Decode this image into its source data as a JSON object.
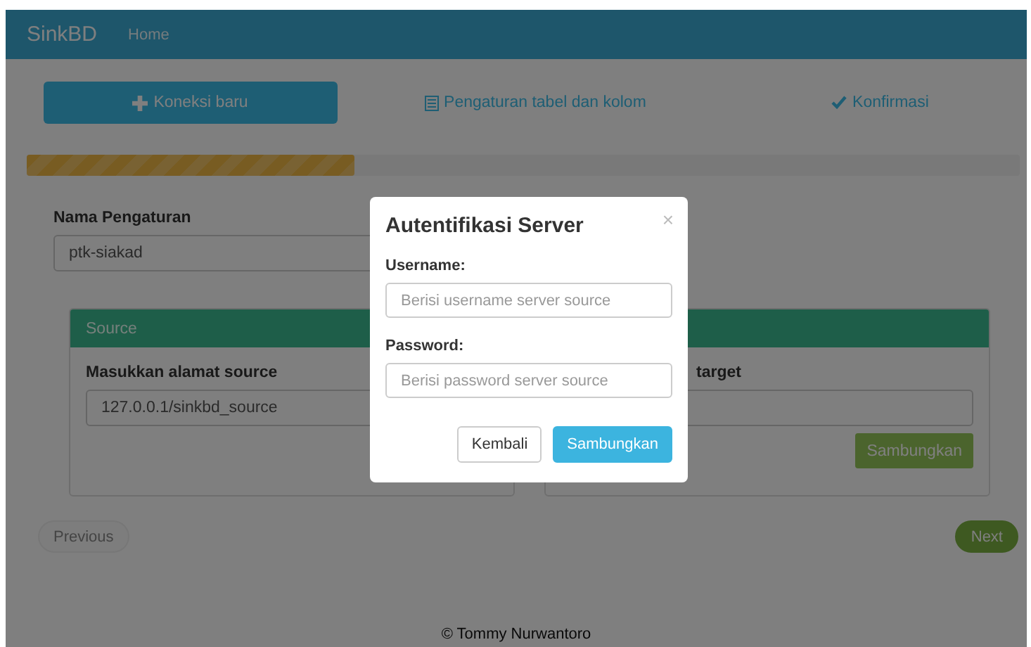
{
  "navbar": {
    "brand": "SinkBD",
    "links": [
      {
        "label": "Home"
      }
    ]
  },
  "steps": [
    {
      "label": "Koneksi baru",
      "kind": "plus",
      "selected": true
    },
    {
      "label": "Pengaturan tabel dan kolom",
      "kind": "table",
      "selected": false
    },
    {
      "label": "Konfirmasi",
      "kind": "check",
      "selected": false
    }
  ],
  "progress": {
    "level": 0.33
  },
  "settings": {
    "label": "Nama Pengaturan",
    "value": "ptk-siakad"
  },
  "panels": [
    {
      "header": "Source",
      "label": "Masukkan alamat source",
      "value": "127.0.0.1/sinkbd_source"
    },
    {
      "label": "target",
      "button": "Sambungkan"
    }
  ],
  "nav_buttons": [
    {
      "label": "Previous",
      "disabled": true
    },
    {
      "label": "Next",
      "disabled": false
    }
  ],
  "footer": "© Tommy Nurwantoro",
  "modal": {
    "title": "Autentifikasi Server",
    "close": "×",
    "fields": [
      {
        "label": "Username:",
        "placeholder": "Berisi username server source"
      },
      {
        "label": "Password:",
        "placeholder": "Berisi password server source"
      }
    ],
    "buttons": [
      {
        "label": "Kembali",
        "kind": "default"
      },
      {
        "label": "Sambungkan",
        "kind": "primary"
      }
    ]
  }
}
